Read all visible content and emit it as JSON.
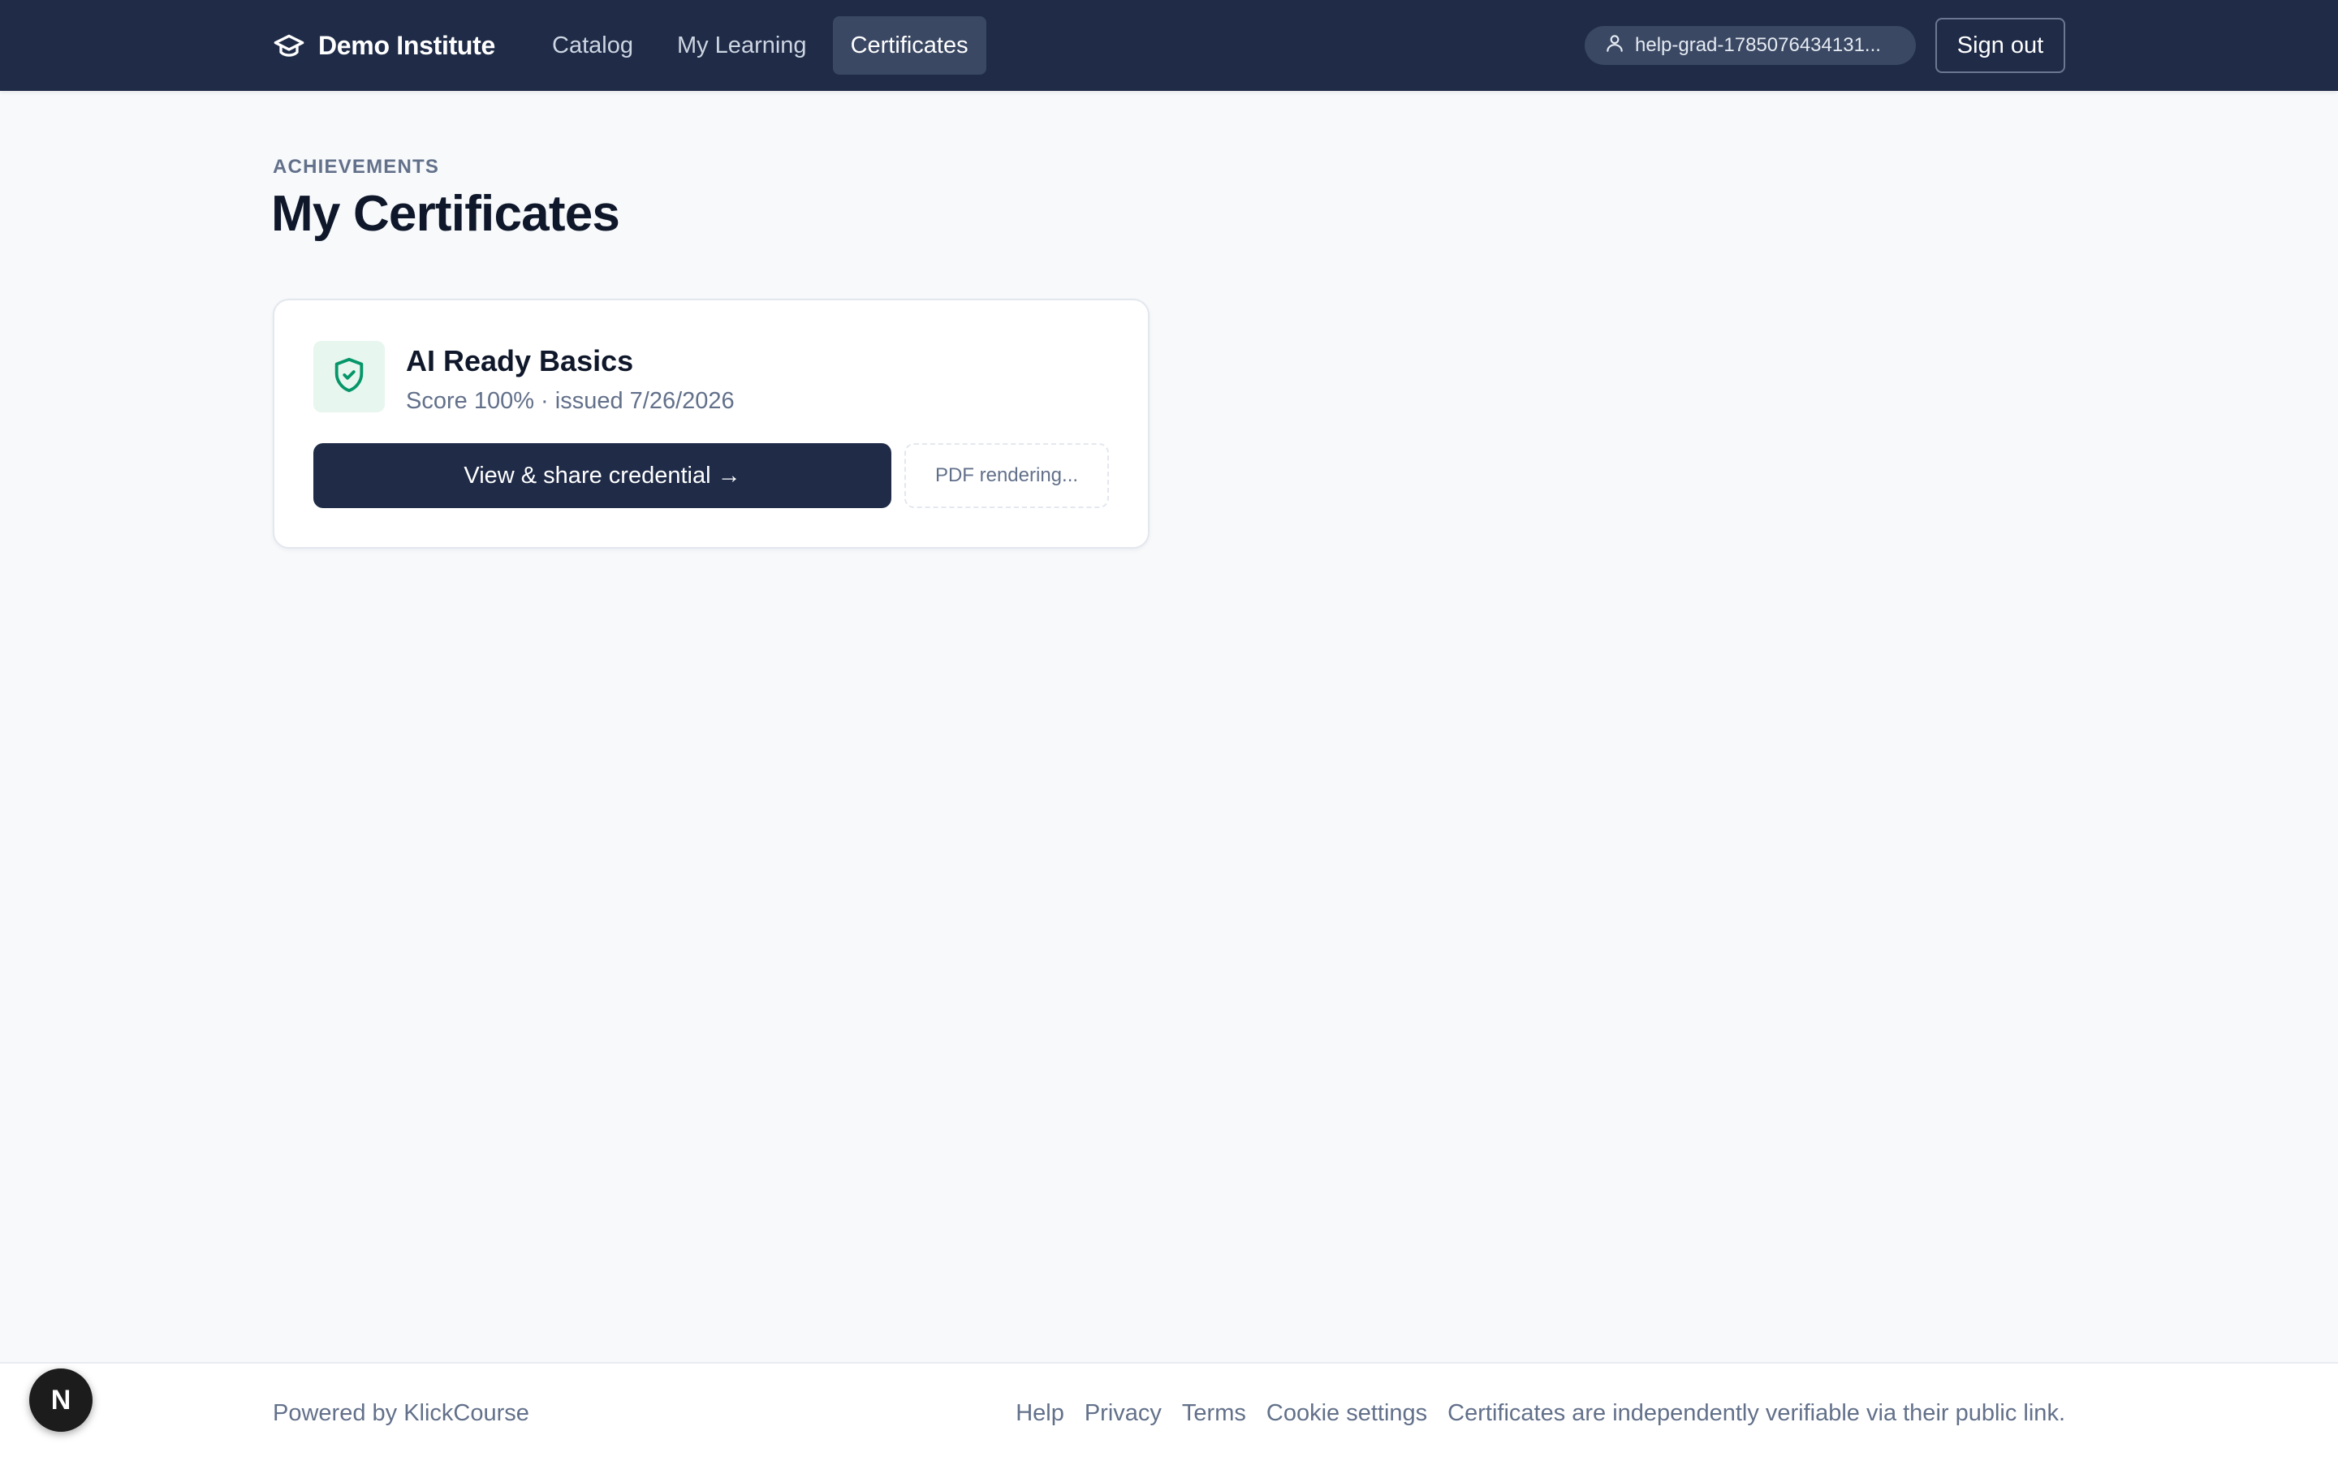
{
  "header": {
    "brand": "Demo Institute",
    "brand_icon": "graduation-cap-icon",
    "nav": [
      {
        "label": "Catalog",
        "active": false
      },
      {
        "label": "My Learning",
        "active": false
      },
      {
        "label": "Certificates",
        "active": true
      }
    ],
    "user": "help-grad-1785076434131...",
    "user_icon": "user-icon",
    "sign_out": "Sign out"
  },
  "main": {
    "eyebrow": "ACHIEVEMENTS",
    "title": "My Certificates",
    "certificates": [
      {
        "icon": "shield-check-icon",
        "name": "AI Ready Basics",
        "meta": "Score 100% · issued 7/26/2026",
        "view_button": "View & share credential →",
        "pdf_status": "PDF rendering..."
      }
    ]
  },
  "footer": {
    "powered_by": "Powered by KlickCourse",
    "links": [
      "Help",
      "Privacy",
      "Terms",
      "Cookie settings"
    ],
    "note": "Certificates are independently verifiable via their public link."
  },
  "dev_badge": {
    "label": "N",
    "icon": "nextjs-icon"
  },
  "colors": {
    "header_bg": "#1f2b47",
    "active_nav_bg": "#3a4863",
    "page_bg": "#f7f9fb",
    "accent_green": "#059669",
    "badge_bg": "#e7f6ee",
    "muted_text": "#62708a"
  }
}
